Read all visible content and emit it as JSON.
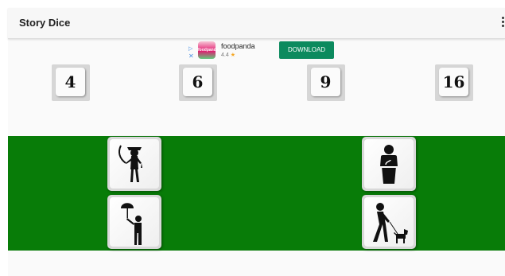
{
  "app": {
    "title": "Story Dice"
  },
  "ad": {
    "app_name": "foodpanda",
    "rating": "4.4",
    "rating_star": "★",
    "cta": "DOWNLOAD",
    "logo_text": "foodpanda",
    "choices_play": "▷",
    "choices_close": "✕"
  },
  "dice": [
    "4",
    "6",
    "9",
    "16"
  ],
  "story_images": [
    {
      "icon": "pirate-with-sword-icon"
    },
    {
      "icon": "speaker-at-podium-icon"
    },
    {
      "icon": "man-with-umbrella-icon"
    },
    {
      "icon": "man-walking-dog-icon"
    }
  ],
  "colors": {
    "green_panel": "#087c08",
    "ad_button": "#0c8a5e"
  }
}
